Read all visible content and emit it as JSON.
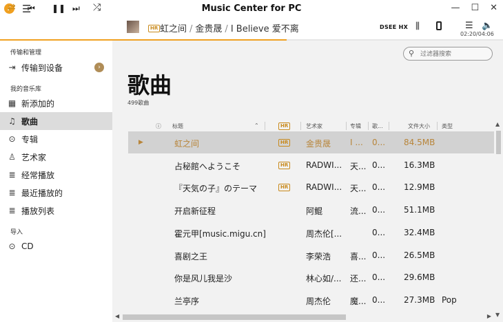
{
  "app": {
    "title": "Music Center for PC"
  },
  "now_playing": {
    "badge": "HR",
    "title": "虹之间",
    "artist": "金贵晟",
    "album": "I Believe 爱不离",
    "separator": "/",
    "time": "02:20/04:06",
    "progress": 0.57,
    "output_label": "DSEE HX"
  },
  "sidebar": {
    "sections": [
      {
        "label": "传输和管理"
      },
      {
        "label": "我的音乐库"
      },
      {
        "label": "导入"
      }
    ],
    "items": [
      {
        "label": "传输到设备",
        "icon": "transfer-icon"
      },
      {
        "label": "新添加的",
        "icon": "new-added-icon"
      },
      {
        "label": "歌曲",
        "icon": "music-note-icon"
      },
      {
        "label": "专辑",
        "icon": "album-icon"
      },
      {
        "label": "艺术家",
        "icon": "artist-icon"
      },
      {
        "label": "经常播放",
        "icon": "frequent-icon"
      },
      {
        "label": "最近播放的",
        "icon": "recent-icon"
      },
      {
        "label": "播放列表",
        "icon": "playlist-icon"
      },
      {
        "label": "CD",
        "icon": "cd-icon"
      }
    ]
  },
  "main": {
    "title": "歌曲",
    "count": "499歌曲",
    "filter_placeholder": "过滤器搜索"
  },
  "table": {
    "headers": {
      "info": "ⓘ",
      "title": "标题",
      "hr": "HR",
      "artist": "艺术家",
      "album": "专辑",
      "genre_short": "歌...",
      "size": "文件大小",
      "type": "类型"
    },
    "rows": [
      {
        "title": "虹之间",
        "hr": "HR",
        "artist": "金贵晟",
        "album": "I ...",
        "col5": "0...",
        "size": "84.5MB",
        "type": "",
        "selected": true
      },
      {
        "title": "占秘館へようこそ",
        "hr": "HR",
        "artist": "RADWI...",
        "album": "天...",
        "col5": "0...",
        "size": "16.3MB",
        "type": ""
      },
      {
        "title": "『天気の子』のテーマ",
        "hr": "HR",
        "artist": "RADWI...",
        "album": "天...",
        "col5": "0...",
        "size": "12.9MB",
        "type": ""
      },
      {
        "title": "开启新征程",
        "hr": "",
        "artist": "阿鲲",
        "album": "流...",
        "col5": "0...",
        "size": "51.1MB",
        "type": ""
      },
      {
        "title": "霍元甲[music.migu.cn]",
        "hr": "",
        "artist": "周杰伦[...",
        "album": "",
        "col5": "0...",
        "size": "32.4MB",
        "type": ""
      },
      {
        "title": "喜剧之王",
        "hr": "",
        "artist": "李荣浩",
        "album": "喜...",
        "col5": "0...",
        "size": "26.5MB",
        "type": ""
      },
      {
        "title": "你是风儿我是沙",
        "hr": "",
        "artist": "林心如/...",
        "album": "还...",
        "col5": "0...",
        "size": "29.6MB",
        "type": ""
      },
      {
        "title": "兰亭序",
        "hr": "",
        "artist": "周杰伦",
        "album": "魔...",
        "col5": "0...",
        "size": "27.3MB",
        "type": "Pop"
      }
    ]
  },
  "colors": {
    "accent": "#f0a020",
    "selected_text": "#b8853a",
    "sidebar_active": "#dcdcdc",
    "main_bg": "#f2f2f2"
  }
}
